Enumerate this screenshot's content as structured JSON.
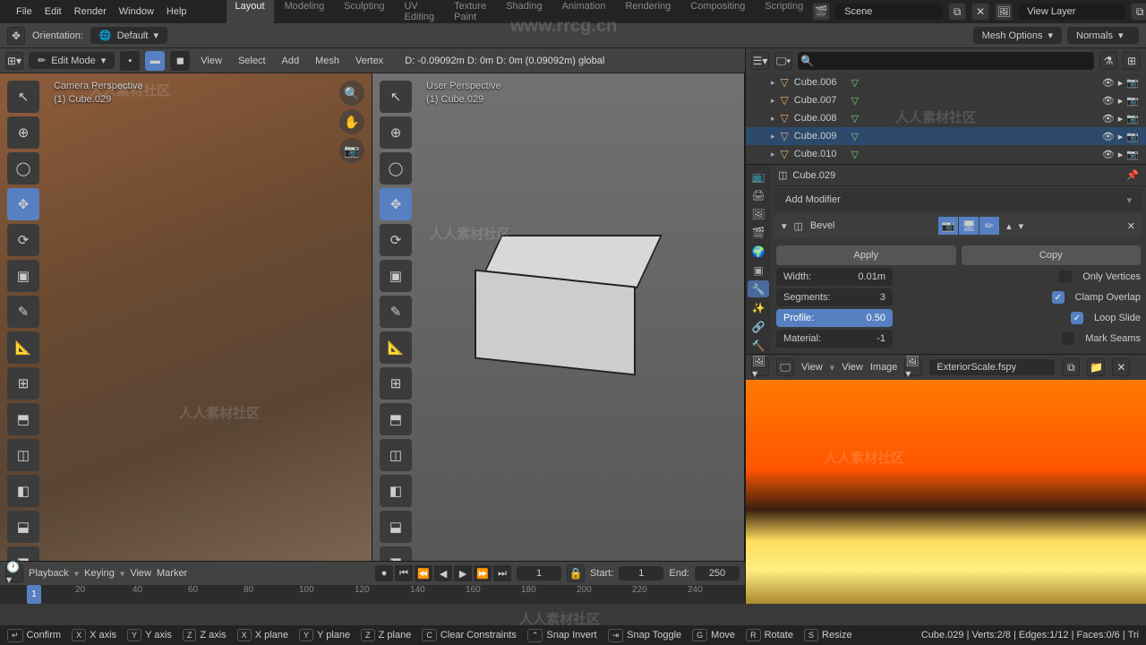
{
  "watermark_url": "www.rrcg.cn",
  "watermark_cn": "人人素材社区",
  "topmenu": {
    "file": "File",
    "edit": "Edit",
    "render": "Render",
    "window": "Window",
    "help": "Help"
  },
  "workspaces": {
    "layout": "Layout",
    "modeling": "Modeling",
    "sculpting": "Sculpting",
    "uv": "UV Editing",
    "texture": "Texture Paint",
    "shading": "Shading",
    "animation": "Animation",
    "rendering": "Rendering",
    "compositing": "Compositing",
    "scripting": "Scripting"
  },
  "scene": "Scene",
  "view_layer": "View Layer",
  "orientation_label": "Orientation:",
  "pivot": "Default",
  "mesh_options": "Mesh Options",
  "normals": "Normals",
  "editor": {
    "mode": "Edit Mode",
    "menus": {
      "view": "View",
      "select": "Select",
      "add": "Add",
      "mesh": "Mesh",
      "vertex": "Vertex"
    },
    "status": "D: -0.09092m   D: 0m   D: 0m (0.09092m) global"
  },
  "viewport1": {
    "title": "Camera Perspective",
    "object": "(1) Cube.029"
  },
  "viewport2": {
    "title": "User Perspective",
    "object": "(1) Cube.029"
  },
  "outliner": {
    "items": [
      {
        "name": "Cube.006",
        "sel": false
      },
      {
        "name": "Cube.007",
        "sel": false
      },
      {
        "name": "Cube.008",
        "sel": false
      },
      {
        "name": "Cube.009",
        "sel": true
      },
      {
        "name": "Cube.010",
        "sel": false
      }
    ]
  },
  "props": {
    "breadcrumb": "Cube.029",
    "add_modifier": "Add Modifier",
    "modifier_name": "Bevel",
    "apply": "Apply",
    "copy": "Copy",
    "width_label": "Width:",
    "width_val": "0.01m",
    "segments_label": "Segments:",
    "segments_val": "3",
    "profile_label": "Profile:",
    "profile_val": "0.50",
    "material_label": "Material:",
    "material_val": "-1",
    "only_vertices": "Only Vertices",
    "clamp_overlap": "Clamp Overlap",
    "loop_slide": "Loop Slide",
    "mark_seams": "Mark Seams"
  },
  "image_editor": {
    "menus": {
      "view_dd": "View",
      "view": "View",
      "image": "Image"
    },
    "image_name": "ExteriorScale.fspy"
  },
  "timeline": {
    "menus": {
      "playback": "Playback",
      "keying": "Keying",
      "view": "View",
      "marker": "Marker"
    },
    "current": "1",
    "start_label": "Start:",
    "start": "1",
    "end_label": "End:",
    "end": "250",
    "ticks": [
      "20",
      "40",
      "60",
      "80",
      "100",
      "120",
      "140",
      "160",
      "180",
      "200",
      "220",
      "240"
    ]
  },
  "statusbar": {
    "confirm": "Confirm",
    "x_axis": "X axis",
    "y_axis": "Y axis",
    "z_axis": "Z axis",
    "x_plane": "X plane",
    "y_plane": "Y plane",
    "z_plane": "Z plane",
    "clear": "Clear Constraints",
    "snap_invert": "Snap Invert",
    "snap_toggle": "Snap Toggle",
    "move": "Move",
    "rotate": "Rotate",
    "resize": "Resize",
    "info": "Cube.029 | Verts:2/8 | Edges:1/12 | Faces:0/6 | Tri"
  }
}
